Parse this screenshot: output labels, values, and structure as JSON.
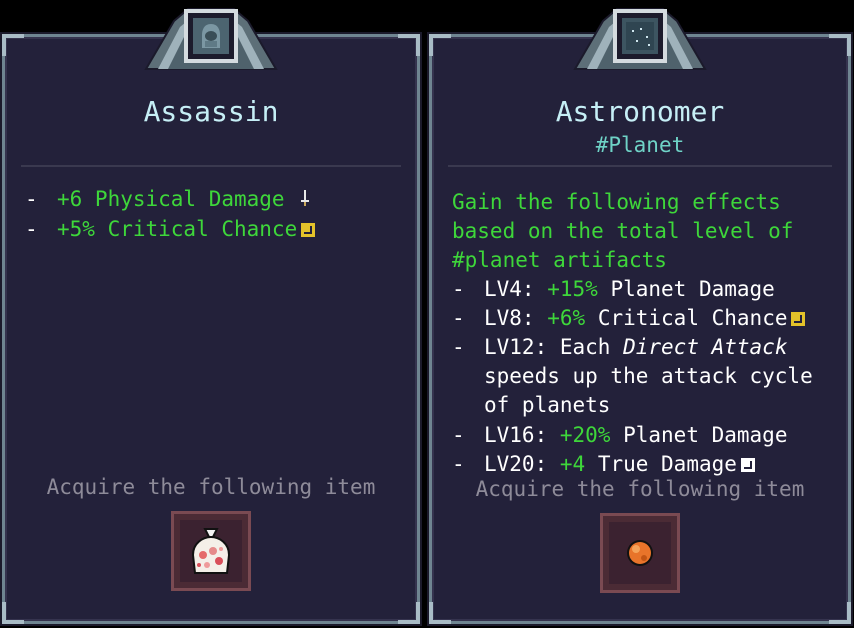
{
  "colors": {
    "card_bg": "#23213a",
    "title": "#c6eff6",
    "subtitle": "#6fd3c7",
    "green": "#3ed73a",
    "muted": "#8e8b99",
    "frame": "#6f8591"
  },
  "left_card": {
    "title": "Assassin",
    "icon": "assassin-hood-icon",
    "bullets": [
      {
        "dash": "-",
        "text": "+6 Physical Damage",
        "icon": "sword-icon"
      },
      {
        "dash": "-",
        "text": "+5% Critical Chance",
        "icon": "critical-arrow-icon"
      }
    ],
    "acquire_label": "Acquire the following item",
    "item_icon": "flower-bag-icon"
  },
  "right_card": {
    "title": "Astronomer",
    "subtitle": "#Planet",
    "icon": "star-map-icon",
    "description": "Gain the following effects based on the total level of #planet artifacts",
    "levels": [
      {
        "dash": "-",
        "level": "LV4:",
        "value": "+15%",
        "text": "Planet Damage"
      },
      {
        "dash": "-",
        "level": "LV8:",
        "value": "+6%",
        "text": "Critical Chance",
        "icon": "critical-arrow-icon"
      },
      {
        "dash": "-",
        "level": "LV12:",
        "pre": "Each",
        "emph": "Direct Attack",
        "cont1": "speeds up the attack cycle",
        "cont2": "of planets"
      },
      {
        "dash": "-",
        "level": "LV16:",
        "value": "+20%",
        "text": "Planet Damage"
      },
      {
        "dash": "-",
        "level": "LV20:",
        "value": "+4",
        "text": "True Damage",
        "icon": "true-damage-icon"
      }
    ],
    "acquire_label": "Acquire the following item",
    "item_icon": "orange-planet-icon"
  }
}
